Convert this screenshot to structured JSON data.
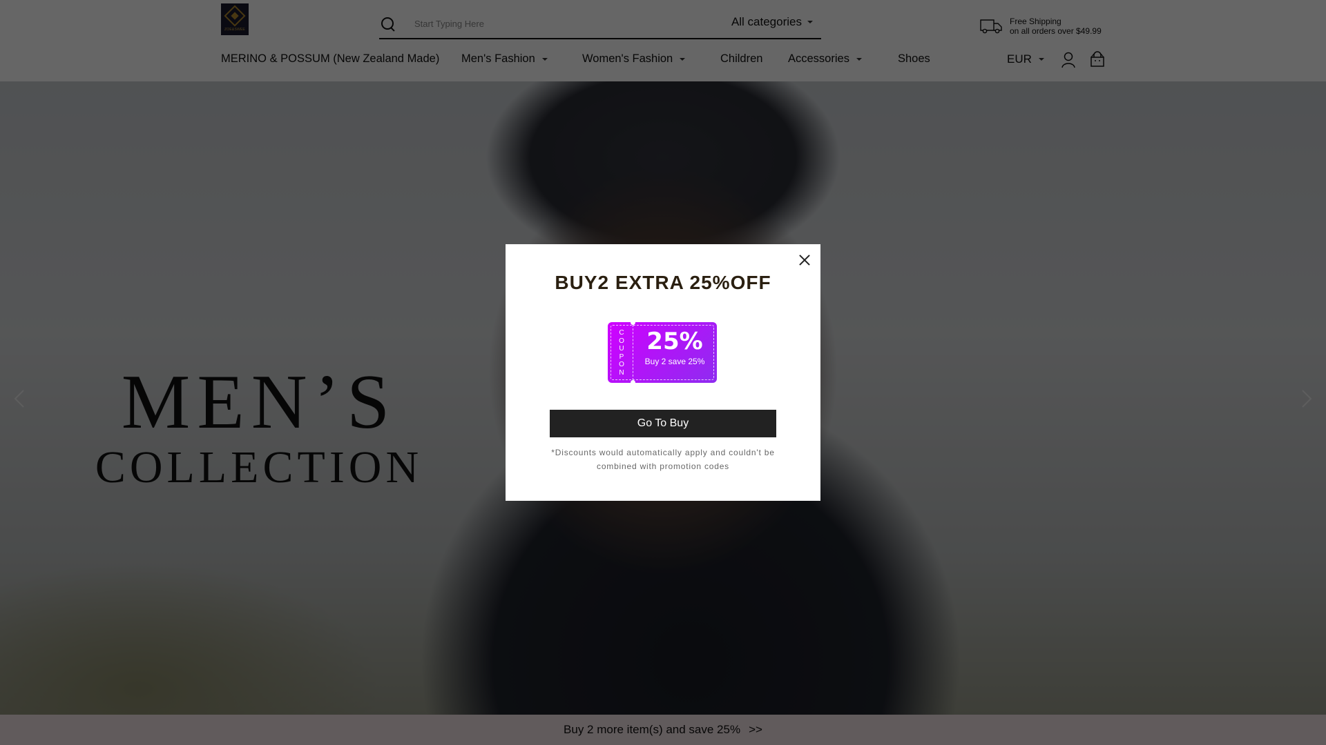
{
  "header": {
    "logo_text": "ZOE&SWEE",
    "search": {
      "placeholder": "Start Typing Here",
      "value": ""
    },
    "categories_label": "All categories",
    "shipping": {
      "line1": "Free Shipping",
      "line2": "on all orders over $49.99"
    },
    "nav": [
      {
        "label": "MERINO & POSSUM (New Zealand Made)",
        "has_dropdown": false
      },
      {
        "label": "Men's Fashion",
        "has_dropdown": true
      },
      {
        "label": "Women's Fashion",
        "has_dropdown": true
      },
      {
        "label": "Children",
        "has_dropdown": false
      },
      {
        "label": "Accessories",
        "has_dropdown": true
      },
      {
        "label": "Shoes",
        "has_dropdown": false
      }
    ],
    "currency": "EUR"
  },
  "hero": {
    "title_line1": "MEN’S",
    "title_line2": "COLLECTION"
  },
  "promo_bar": {
    "text": "Buy 2 more item(s) and save 25%",
    "chevron": ">>"
  },
  "modal": {
    "title": "BUY2 EXTRA 25%OFF",
    "coupon": {
      "side_label": [
        "C",
        "O",
        "U",
        "P",
        "O",
        "N"
      ],
      "percent": "25%",
      "subtitle": "Buy 2 save 25%",
      "color_start": "#d000ff",
      "color_end": "#8e2cf0"
    },
    "button_label": "Go To Buy",
    "disclaimer": "*Discounts would automatically apply and couldn't be combined with promotion codes"
  }
}
